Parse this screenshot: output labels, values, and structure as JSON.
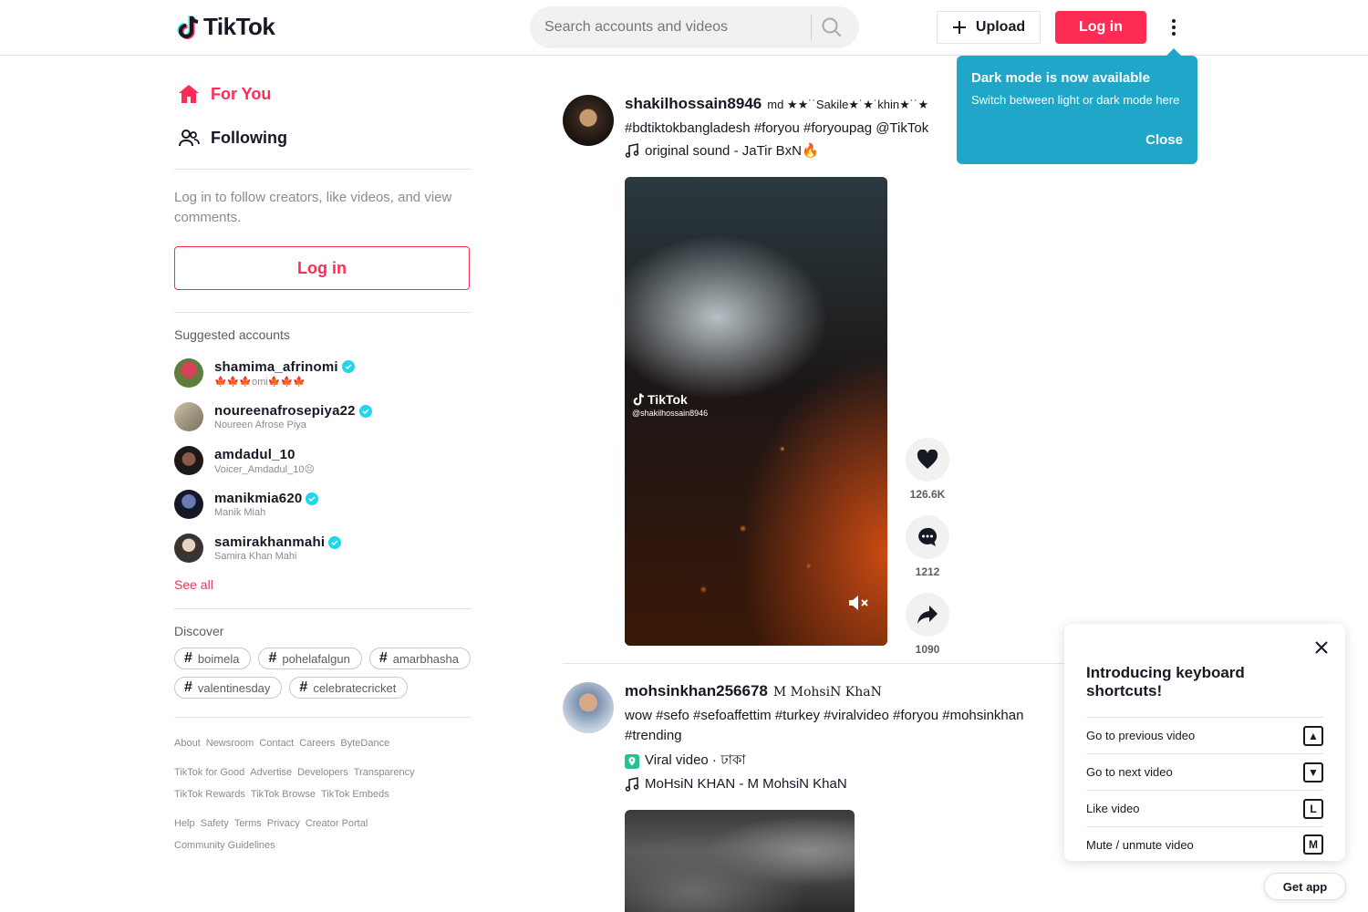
{
  "header": {
    "logo_text": "TikTok",
    "search_placeholder": "Search accounts and videos",
    "upload_label": "Upload",
    "login_label": "Log in"
  },
  "dark_mode_tip": {
    "title": "Dark mode is now available",
    "body": "Switch between light or dark mode here",
    "close_label": "Close"
  },
  "sidebar": {
    "nav": [
      {
        "label": "For You",
        "icon": "home-icon",
        "active": true
      },
      {
        "label": "Following",
        "icon": "users-icon",
        "active": false
      }
    ],
    "login_hint": "Log in to follow creators, like videos, and view comments.",
    "login_button": "Log in",
    "suggested_title": "Suggested accounts",
    "accounts": [
      {
        "name": "shamima_afrinomi",
        "sub": "🍁🍁🍁omi🍁🍁🍁",
        "verified": true,
        "color": "#b23a48"
      },
      {
        "name": "noureenafrosepiya22",
        "sub": "Noureen Afrose Piya",
        "verified": true,
        "color": "#9a8f7a"
      },
      {
        "name": "amdadul_10",
        "sub": "Voicer_Amdadul_10😣",
        "verified": false,
        "color": "#3a2f2f"
      },
      {
        "name": "manikmia620",
        "sub": "Manik Miah",
        "verified": true,
        "color": "#2a2f4a"
      },
      {
        "name": "samirakhanmahi",
        "sub": "Samira Khan Mahi",
        "verified": true,
        "color": "#4a4440"
      }
    ],
    "see_all": "See all",
    "discover_title": "Discover",
    "tags": [
      "boimela",
      "pohelafalgun",
      "amarbhasha",
      "valentinesday",
      "celebratecricket"
    ],
    "footer": [
      [
        "About",
        "Newsroom",
        "Contact",
        "Careers",
        "ByteDance"
      ],
      [
        "TikTok for Good",
        "Advertise",
        "Developers",
        "Transparency"
      ],
      [
        "TikTok Rewards",
        "TikTok Browse",
        "TikTok Embeds"
      ],
      [
        "Help",
        "Safety",
        "Terms",
        "Privacy",
        "Creator Portal"
      ],
      [
        "Community Guidelines"
      ]
    ]
  },
  "posts": [
    {
      "author": "shakilhossain8946",
      "nickname": "md ★★˙˙Sakile★˙★˙khin★˙˙★",
      "caption": "#bdtiktokbangladesh #foryou #foryoupag @TikTok",
      "music": "original sound - JaTir BxN🔥",
      "watermark_handle": "@shakilhossain8946",
      "watermark_logo": "TikTok",
      "likes": "126.6K",
      "comments": "1212",
      "shares": "1090"
    },
    {
      "author": "mohsinkhan256678",
      "nickname": "M MohsiN KhaN",
      "caption": "wow #sefo #sefoaffettim #turkey #viralvideo #foryou #mohsinkhan #trending",
      "location": "Viral video · ঢাকা",
      "music": "MoHsiN KHAN - M MohsiN KhaN"
    }
  ],
  "shortcuts": {
    "title": "Introducing keyboard shortcuts!",
    "items": [
      {
        "label": "Go to previous video",
        "key": "▲"
      },
      {
        "label": "Go to next video",
        "key": "▼"
      },
      {
        "label": "Like video",
        "key": "L"
      },
      {
        "label": "Mute / unmute video",
        "key": "M"
      }
    ]
  },
  "get_app": "Get app",
  "colors": {
    "brand": "#fe2c55",
    "tooltip": "#20a6c8",
    "verified": "#20d5ec"
  }
}
